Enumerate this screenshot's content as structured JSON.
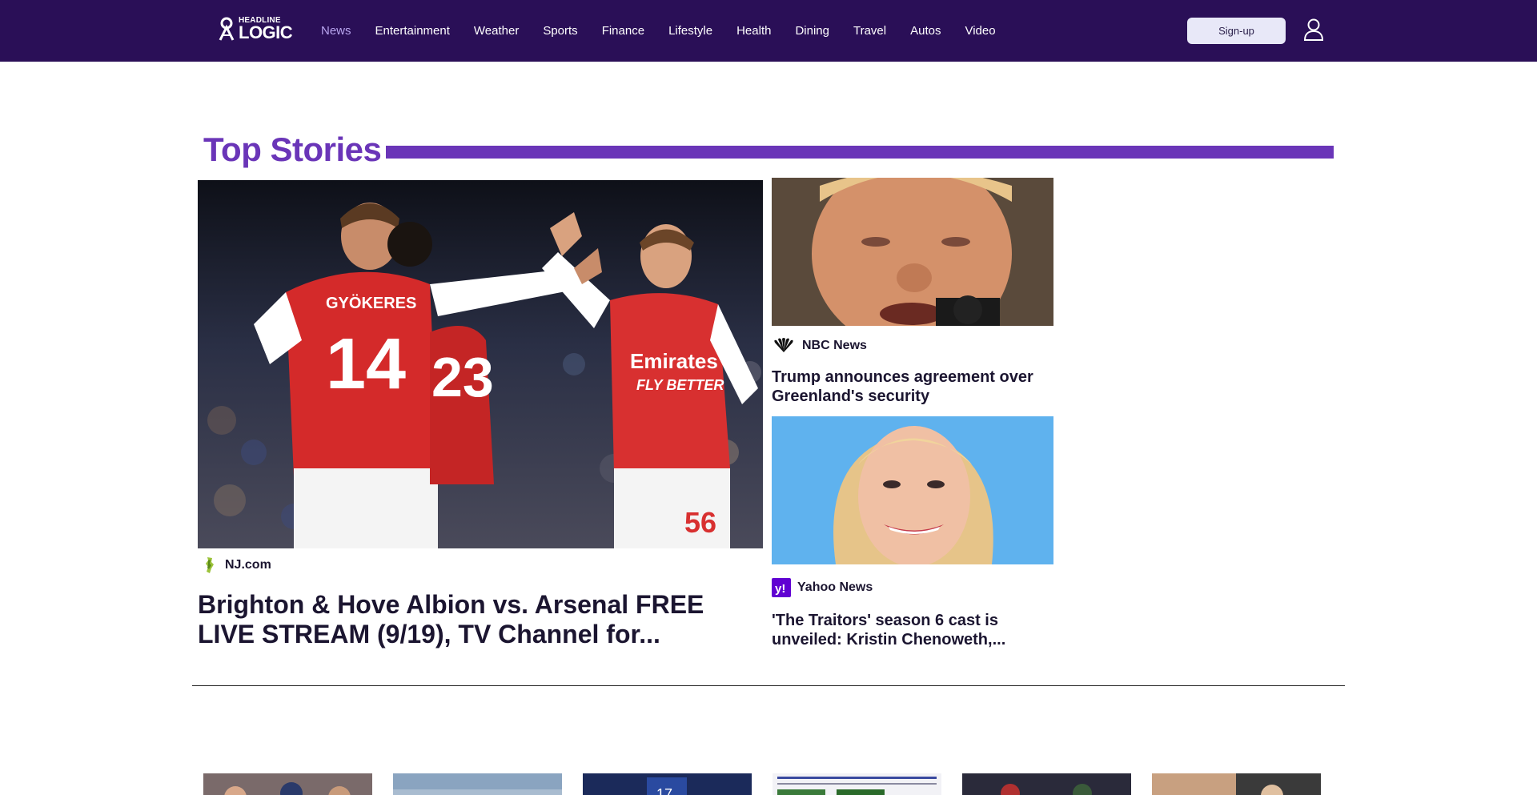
{
  "header": {
    "logo_line1": "HEADLINE",
    "logo_line2": "LOGIC",
    "nav": [
      {
        "label": "News",
        "active": true
      },
      {
        "label": "Entertainment",
        "active": false
      },
      {
        "label": "Weather",
        "active": false
      },
      {
        "label": "Sports",
        "active": false
      },
      {
        "label": "Finance",
        "active": false
      },
      {
        "label": "Lifestyle",
        "active": false
      },
      {
        "label": "Health",
        "active": false
      },
      {
        "label": "Dining",
        "active": false
      },
      {
        "label": "Travel",
        "active": false
      },
      {
        "label": "Autos",
        "active": false
      },
      {
        "label": "Video",
        "active": false
      }
    ],
    "signup_label": "Sign-up",
    "user_icon": "user-icon"
  },
  "top_stories": {
    "title": "Top Stories",
    "main": {
      "source": "NJ.com",
      "source_icon": "new-jersey-icon",
      "headline": "Brighton & Hove Albion vs. Arsenal FREE LIVE STREAM (9/19), TV Channel for..."
    },
    "side": [
      {
        "source": "NBC News",
        "source_icon": "peacock-icon",
        "headline": "Trump announces agreement over Greenland's security"
      },
      {
        "source": "Yahoo News",
        "source_icon": "yahoo-icon",
        "headline": "'The Traitors' season 6 cast is unveiled: Kristin Chenoweth,..."
      }
    ]
  },
  "colors": {
    "header_bg": "#2a0f57",
    "accent": "#6a35b8",
    "nav_active": "#b9a6f0",
    "signup_bg": "#e8e8f8"
  }
}
